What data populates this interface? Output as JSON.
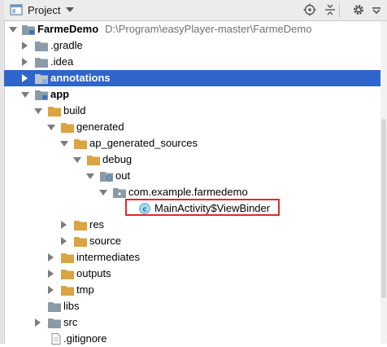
{
  "header": {
    "title": "Project",
    "tools": [
      "locate-icon",
      "collapse-all-icon",
      "settings-icon",
      "hide-icon"
    ]
  },
  "tree": {
    "rows": [
      {
        "label": "FarmeDemo",
        "path": "D:\\Program\\easyPlayer-master\\FarmeDemo",
        "icon": "module-folder",
        "expanded": true
      },
      {
        "label": ".gradle",
        "icon": "folder-gray",
        "expanded": false
      },
      {
        "label": ".idea",
        "icon": "folder-gray",
        "expanded": false
      },
      {
        "label": "annotations",
        "icon": "module-folder",
        "expanded": false,
        "selected": true
      },
      {
        "label": "app",
        "icon": "module-folder",
        "expanded": true
      },
      {
        "label": "build",
        "icon": "folder-orange",
        "expanded": true
      },
      {
        "label": "generated",
        "icon": "folder-orange",
        "expanded": true
      },
      {
        "label": "ap_generated_sources",
        "icon": "folder-orange",
        "expanded": true
      },
      {
        "label": "debug",
        "icon": "folder-orange",
        "expanded": true
      },
      {
        "label": "out",
        "icon": "source-folder",
        "expanded": true
      },
      {
        "label": "com.example.farmedemo",
        "icon": "package-folder",
        "expanded": true
      },
      {
        "label": "MainActivity$ViewBinder",
        "icon": "class-file"
      },
      {
        "label": "res",
        "icon": "folder-orange",
        "expanded": false
      },
      {
        "label": "source",
        "icon": "folder-orange",
        "expanded": false
      },
      {
        "label": "intermediates",
        "icon": "folder-orange",
        "expanded": false
      },
      {
        "label": "outputs",
        "icon": "folder-orange",
        "expanded": false
      },
      {
        "label": "tmp",
        "icon": "folder-orange",
        "expanded": false
      },
      {
        "label": "libs",
        "icon": "folder-gray"
      },
      {
        "label": "src",
        "icon": "folder-gray",
        "expanded": false
      },
      {
        "label": ".gitignore",
        "icon": "file-icon"
      }
    ]
  },
  "colors": {
    "selection": "#2f65ca",
    "highlight_border": "#e12a2a",
    "folder_orange": "#d9a441",
    "folder_gray": "#8c9aa5"
  }
}
